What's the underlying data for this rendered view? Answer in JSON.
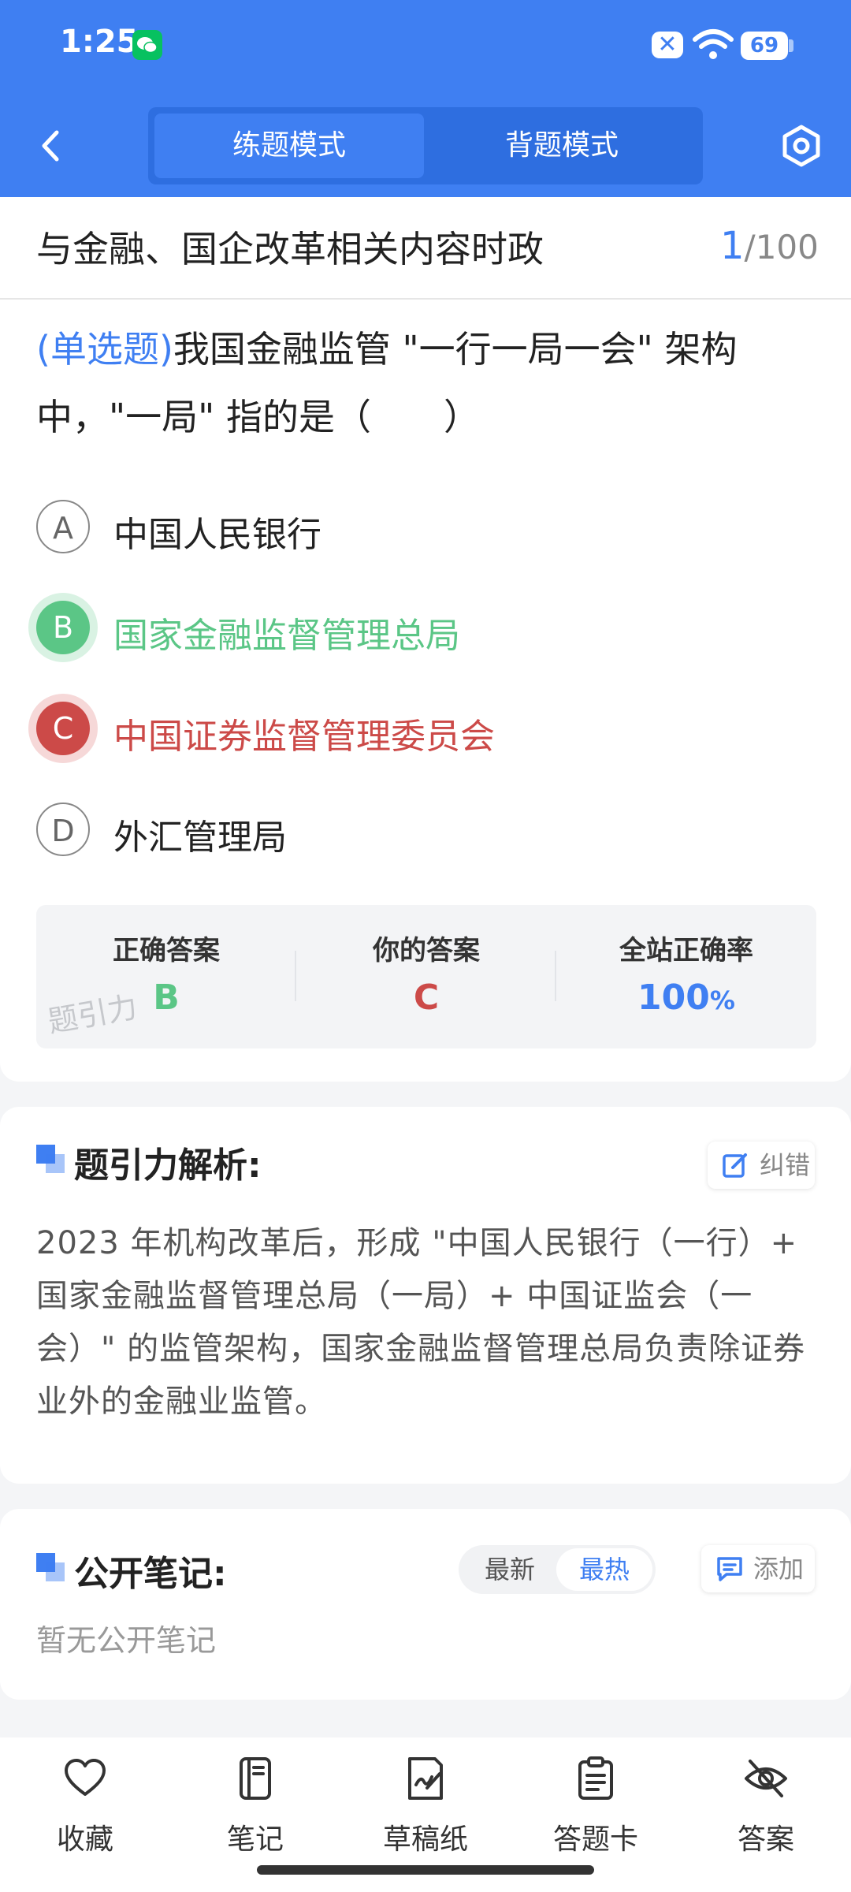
{
  "status_bar": {
    "time": "1:25",
    "battery": "69"
  },
  "header": {
    "modes": [
      "练题模式",
      "背题模式"
    ],
    "active_mode": 0
  },
  "question": {
    "topic_title": "与金融、国企改革相关内容时政",
    "current": "1",
    "total": "/100",
    "type_label": "(单选题)",
    "text": "我国金融监管 \"一行一局一会\" 架构中，\"一局\" 指的是（　　）",
    "options": [
      {
        "letter": "A",
        "text": "中国人民银行",
        "state": "normal"
      },
      {
        "letter": "B",
        "text": "国家金融监督管理总局",
        "state": "correct"
      },
      {
        "letter": "C",
        "text": "中国证券监督管理委员会",
        "state": "wrong"
      },
      {
        "letter": "D",
        "text": "外汇管理局",
        "state": "normal"
      }
    ]
  },
  "stats": {
    "correct_label": "正确答案",
    "correct_value": "B",
    "yours_label": "你的答案",
    "yours_value": "C",
    "rate_label": "全站正确率",
    "rate_value": "100",
    "rate_unit": "%",
    "watermark": "题引力"
  },
  "analysis": {
    "title": "题引力解析:",
    "report_label": "纠错",
    "text": "2023 年机构改革后，形成 \"中国人民银行（一行）+ 国家金融监督管理总局（一局）+ 中国证监会（一会）\" 的监管架构，国家金融监督管理总局负责除证券业外的金融业监管。"
  },
  "notes": {
    "title": "公开笔记:",
    "sort_options": [
      "最新",
      "最热"
    ],
    "active_sort": 1,
    "add_label": "添加",
    "empty_text": "暂无公开笔记"
  },
  "bottom_tabs": [
    {
      "label": "收藏",
      "icon": "heart-icon"
    },
    {
      "label": "笔记",
      "icon": "notebook-icon"
    },
    {
      "label": "草稿纸",
      "icon": "draft-paper-icon"
    },
    {
      "label": "答题卡",
      "icon": "answer-sheet-icon"
    },
    {
      "label": "答案",
      "icon": "eye-off-icon"
    }
  ],
  "colors": {
    "primary": "#3f7ff2",
    "correct": "#5bc686",
    "wrong": "#cc4a48"
  }
}
